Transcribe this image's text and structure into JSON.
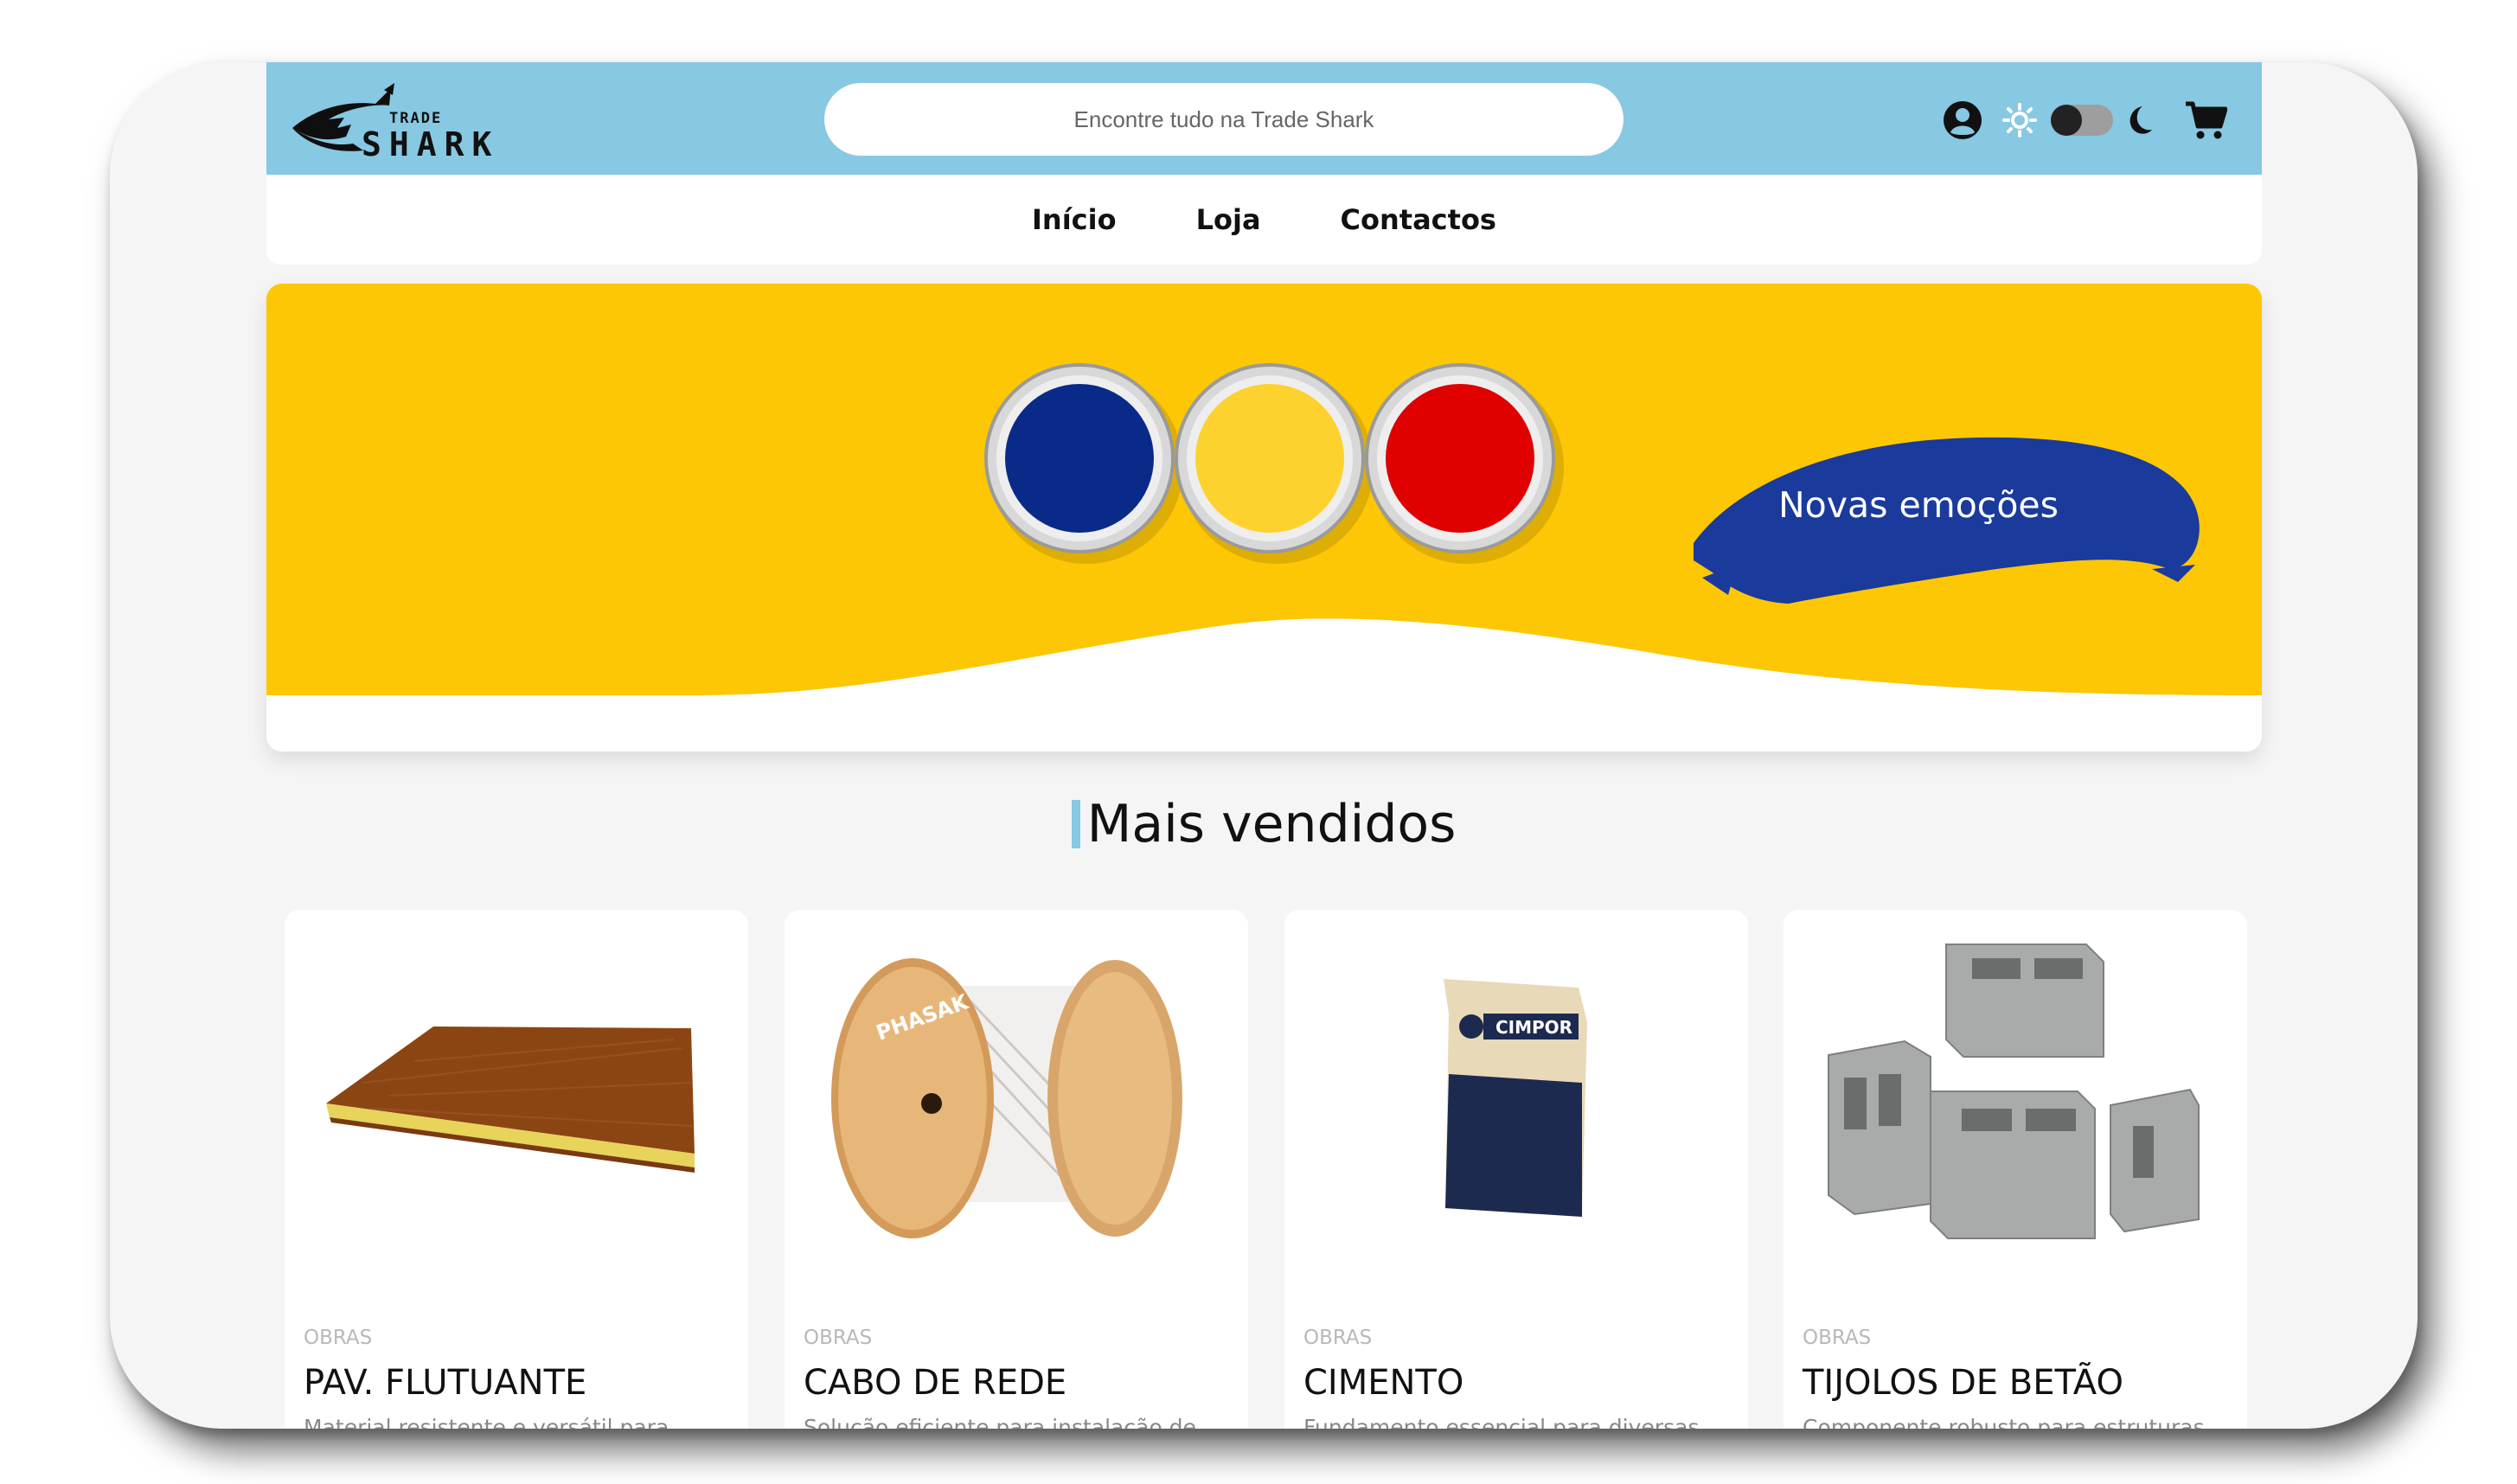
{
  "header": {
    "logo_top": "TRADE",
    "logo_bottom": "SHARK",
    "search_placeholder": "Encontre tudo na Trade Shark"
  },
  "nav": {
    "items": [
      {
        "label": "Início"
      },
      {
        "label": "Loja"
      },
      {
        "label": "Contactos"
      }
    ]
  },
  "banner": {
    "tagline": "Novas emoções",
    "background_color": "#fdc705",
    "paint_colors": [
      "#0a2a8a",
      "#fdd22e",
      "#e00000"
    ],
    "brush_color": "#1a3a9c"
  },
  "section": {
    "title": "Mais vendidos"
  },
  "products": [
    {
      "category": "OBRAS",
      "name": "PAV. FLUTUANTE",
      "description": "Material resistente e versátil para",
      "image_icon": "floor-panel-image"
    },
    {
      "category": "OBRAS",
      "name": "CABO DE REDE",
      "description": "Solução eficiente para instalação de",
      "image_icon": "cable-reel-image",
      "brand": "PHASAK"
    },
    {
      "category": "OBRAS",
      "name": "CIMENTO",
      "description": "Fundamento essencial para diversas",
      "image_icon": "cement-bag-image",
      "brand": "CIMPOR"
    },
    {
      "category": "OBRAS",
      "name": "TIJOLOS DE BETÃO",
      "description": "Componente robusto para estruturas",
      "image_icon": "concrete-blocks-image"
    }
  ],
  "colors": {
    "header_bg": "#87c8e3",
    "accent": "#87c8e3",
    "page_bg": "#f5f5f5"
  }
}
